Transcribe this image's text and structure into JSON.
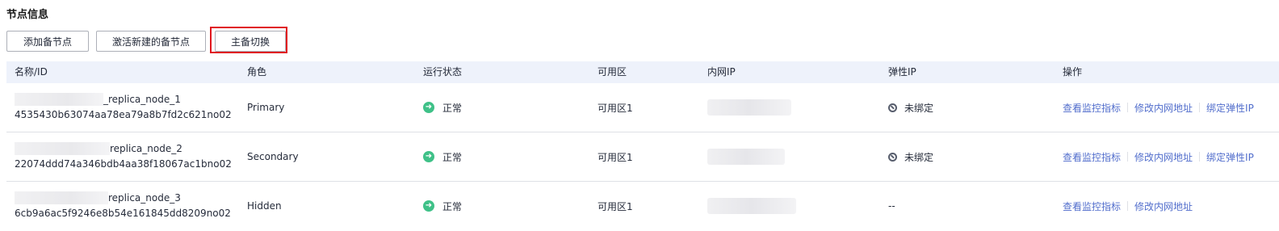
{
  "section_title": "节点信息",
  "toolbar": {
    "add_standby": "添加备节点",
    "activate_new_standby": "激活新建的备节点",
    "switchover": "主备切换"
  },
  "table": {
    "headers": [
      "名称/ID",
      "角色",
      "运行状态",
      "可用区",
      "内网IP",
      "弹性IP",
      "操作"
    ],
    "rows": [
      {
        "name_suffix": "_replica_node_1",
        "id": "4535430b63074aa78ea79a8b7fd2c621no02",
        "role": "Primary",
        "status": "正常",
        "az": "可用区1",
        "eip": "未绑定",
        "actions": [
          "查看监控指标",
          "修改内网地址",
          "绑定弹性IP"
        ]
      },
      {
        "name_suffix": "replica_node_2",
        "id": "22074ddd74a346bdb4aa38f18067ac1bno02",
        "role": "Secondary",
        "status": "正常",
        "az": "可用区1",
        "eip": "未绑定",
        "actions": [
          "查看监控指标",
          "修改内网地址",
          "绑定弹性IP"
        ]
      },
      {
        "name_suffix": "replica_node_3",
        "id": "6cb9a6ac5f9246e8b54e161845dd8209no02",
        "role": "Hidden",
        "status": "正常",
        "az": "可用区1",
        "eip": "--",
        "actions": [
          "查看监控指标",
          "修改内网地址"
        ]
      }
    ]
  },
  "colors": {
    "header_bg": "#eef2fb",
    "link": "#526ecc",
    "status_ok": "#3fc188",
    "highlight": "#e0151e"
  }
}
